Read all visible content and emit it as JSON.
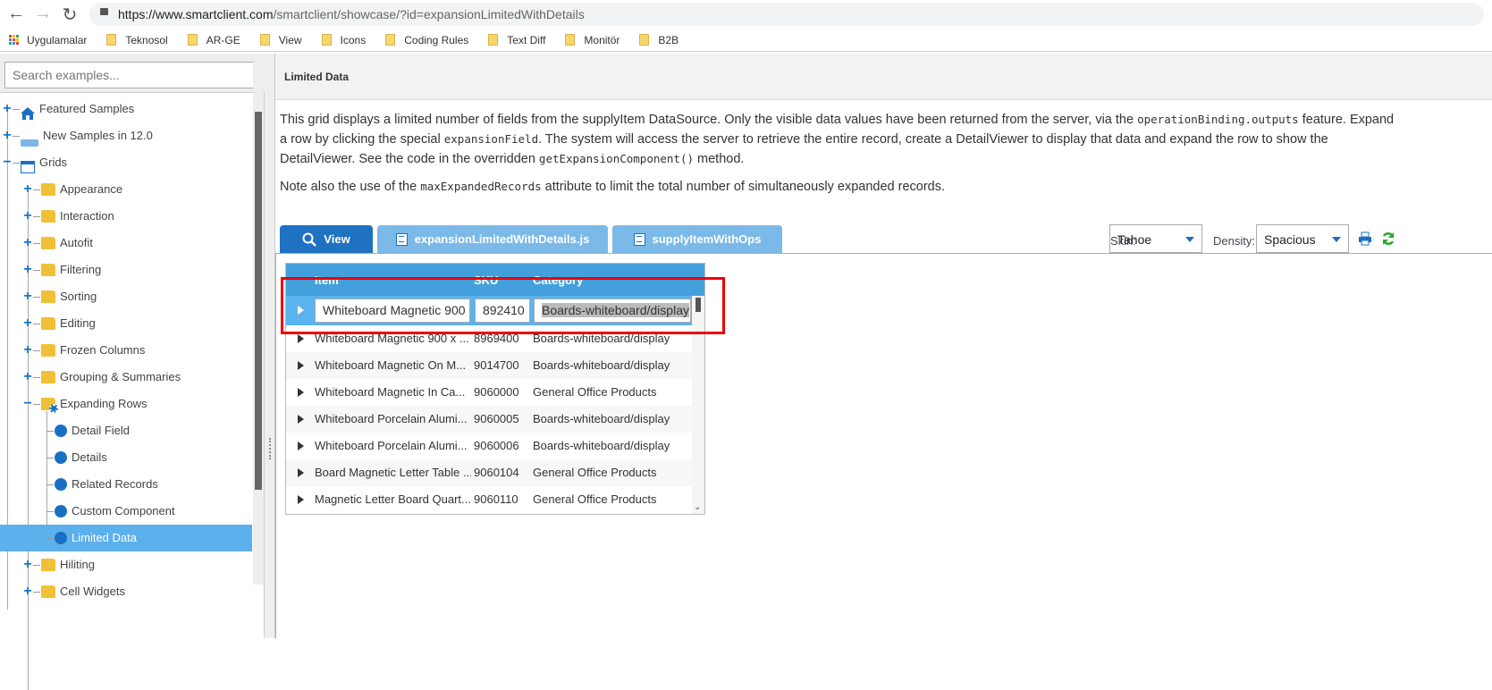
{
  "browser": {
    "url_host": "https://www.smartclient.com",
    "url_path": "/smartclient/showcase/?id=expansionLimitedWithDetails",
    "back_icon": "arrow-left",
    "forward_icon": "arrow-right",
    "reload_icon": "reload",
    "bookmarks": [
      "Uygulamalar",
      "Teknosol",
      "AR-GE",
      "View",
      "Icons",
      "Coding Rules",
      "Text Diff",
      "Monitör",
      "B2B"
    ]
  },
  "sidebar": {
    "search_placeholder": "Search examples...",
    "items": [
      {
        "label": "Featured Samples",
        "icon": "home-icon",
        "level": 0,
        "toggle": "+"
      },
      {
        "label": "New Samples in 12.0",
        "icon": "new-badge-icon",
        "level": 0,
        "toggle": "+"
      },
      {
        "label": "Grids",
        "icon": "grid-icon",
        "level": 0,
        "toggle": "−"
      },
      {
        "label": "Appearance",
        "icon": "folder-icon",
        "level": 1,
        "toggle": "+"
      },
      {
        "label": "Interaction",
        "icon": "folder-icon",
        "level": 1,
        "toggle": "+"
      },
      {
        "label": "Autofit",
        "icon": "folder-icon",
        "level": 1,
        "toggle": "+"
      },
      {
        "label": "Filtering",
        "icon": "folder-icon",
        "level": 1,
        "toggle": "+"
      },
      {
        "label": "Sorting",
        "icon": "folder-icon",
        "level": 1,
        "toggle": "+"
      },
      {
        "label": "Editing",
        "icon": "folder-icon",
        "level": 1,
        "toggle": "+"
      },
      {
        "label": "Frozen Columns",
        "icon": "folder-icon",
        "level": 1,
        "toggle": "+"
      },
      {
        "label": "Grouping & Summaries",
        "icon": "folder-icon",
        "level": 1,
        "toggle": "+"
      },
      {
        "label": "Expanding Rows",
        "icon": "folder-gear-icon",
        "level": 1,
        "toggle": "−"
      },
      {
        "label": "Detail Field",
        "icon": "gear-icon",
        "level": 2
      },
      {
        "label": "Details",
        "icon": "gear-icon",
        "level": 2
      },
      {
        "label": "Related Records",
        "icon": "gear-icon",
        "level": 2
      },
      {
        "label": "Custom Component",
        "icon": "gear-icon",
        "level": 2
      },
      {
        "label": "Limited Data",
        "icon": "gear-icon",
        "level": 2,
        "selected": true
      },
      {
        "label": "Hiliting",
        "icon": "folder-icon",
        "level": 1,
        "toggle": "+"
      },
      {
        "label": "Cell Widgets",
        "icon": "folder-icon",
        "level": 1,
        "toggle": "+"
      }
    ]
  },
  "main": {
    "title": "Limited Data",
    "desc1": [
      "This grid displays a limited number of fields from the supplyItem DataSource. Only the visible data values have been returned from the server, via the ",
      "operationBinding.outputs",
      " feature. Expand a row by clicking the special ",
      "expansionField",
      ". The system will access the server to retrieve the entire record, create a DetailViewer to display that data and expand the row to show the DetailViewer. See the code in the overridden ",
      "getExpansionComponent()",
      " method."
    ],
    "desc2": [
      "Note also the use of the ",
      "maxExpandedRecords",
      " attribute to limit the total number of simultaneously expanded records."
    ],
    "tabs": [
      {
        "label": "View",
        "icon": "search-icon"
      },
      {
        "label": "expansionLimitedWithDetails.js",
        "icon": "document-icon"
      },
      {
        "label": "supplyItemWithOps",
        "icon": "document-icon"
      }
    ],
    "skin_label": "Skin:",
    "skin_value": "Tahoe",
    "density_label": "Density:",
    "density_value": "Spacious"
  },
  "grid": {
    "columns": [
      "Item",
      "SKU",
      "Category"
    ],
    "edit_row": {
      "item": "Whiteboard Magnetic 900",
      "sku": "892410",
      "category": "Boards-whiteboard/display"
    },
    "rows": [
      [
        "Whiteboard Magnetic 900 x ...",
        "8969400",
        "Boards-whiteboard/display"
      ],
      [
        "Whiteboard Magnetic On M...",
        "9014700",
        "Boards-whiteboard/display"
      ],
      [
        "Whiteboard Magnetic In Ca...",
        "9060000",
        "General Office Products"
      ],
      [
        "Whiteboard Porcelain Alumi...",
        "9060005",
        "Boards-whiteboard/display"
      ],
      [
        "Whiteboard Porcelain Alumi...",
        "9060006",
        "Boards-whiteboard/display"
      ],
      [
        "Board Magnetic Letter Table ...",
        "9060104",
        "General Office Products"
      ],
      [
        "Magnetic Letter Board Quart...",
        "9060110",
        "General Office Products"
      ]
    ]
  },
  "colors": {
    "accent": "#1a73c7",
    "header": "#44a0dc",
    "selected": "#5cb0ec",
    "highlight": "#e00000"
  }
}
